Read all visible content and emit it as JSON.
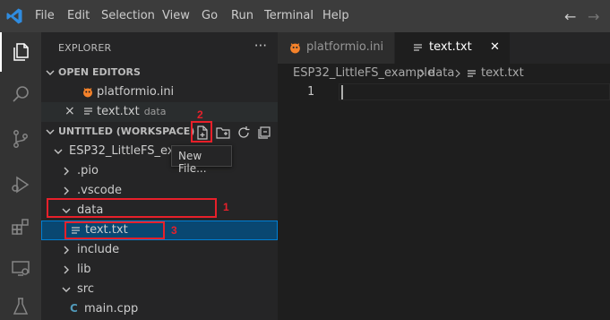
{
  "titlebar": {
    "menu": [
      "File",
      "Edit",
      "Selection",
      "View",
      "Go",
      "Run",
      "Terminal",
      "Help"
    ],
    "back_icon": "←",
    "forward_icon": "→"
  },
  "activity_bar": [
    "explorer-icon",
    "search-icon",
    "source-control-icon",
    "run-debug-icon",
    "extensions-icon",
    "remote-explorer-icon",
    "testing-icon"
  ],
  "sidebar": {
    "title": "EXPLORER",
    "more": "···",
    "open_editors": {
      "title": "OPEN EDITORS",
      "items": [
        {
          "label": "platformio.ini",
          "icon": "platformio-icon"
        },
        {
          "label": "text.txt",
          "sub": "data",
          "icon": "text-file-icon",
          "close": "×"
        }
      ]
    },
    "workspace": {
      "title": "UNTITLED (WORKSPACE)",
      "tree": [
        {
          "label": "ESP32_LittleFS_exam",
          "depth": 1,
          "expanded": true
        },
        {
          "label": ".pio",
          "depth": 2,
          "expanded": false
        },
        {
          "label": ".vscode",
          "depth": 2,
          "expanded": false
        },
        {
          "label": "data",
          "depth": 2,
          "expanded": true
        },
        {
          "label": "text.txt",
          "depth": 3,
          "icon": "text-file-icon"
        },
        {
          "label": "include",
          "depth": 2,
          "expanded": false
        },
        {
          "label": "lib",
          "depth": 2,
          "expanded": false
        },
        {
          "label": "src",
          "depth": 2,
          "expanded": true
        },
        {
          "label": "main.cpp",
          "depth": 3,
          "icon": "cpp-file-icon"
        }
      ]
    },
    "tooltip": "New File...",
    "annotations": [
      "1",
      "2",
      "3"
    ]
  },
  "editor": {
    "tabs": [
      {
        "label": "platformio.ini",
        "active": false,
        "icon": "platformio-icon"
      },
      {
        "label": "text.txt",
        "active": true,
        "icon": "text-file-icon",
        "close": "✕"
      }
    ],
    "breadcrumb": [
      "ESP32_LittleFS_example",
      "data",
      "text.txt"
    ],
    "line_numbers": [
      "1"
    ]
  },
  "colors": {
    "accent": "#007acc",
    "selection": "#094771",
    "annotation": "#e8202a",
    "platformio": "#f5822a"
  }
}
